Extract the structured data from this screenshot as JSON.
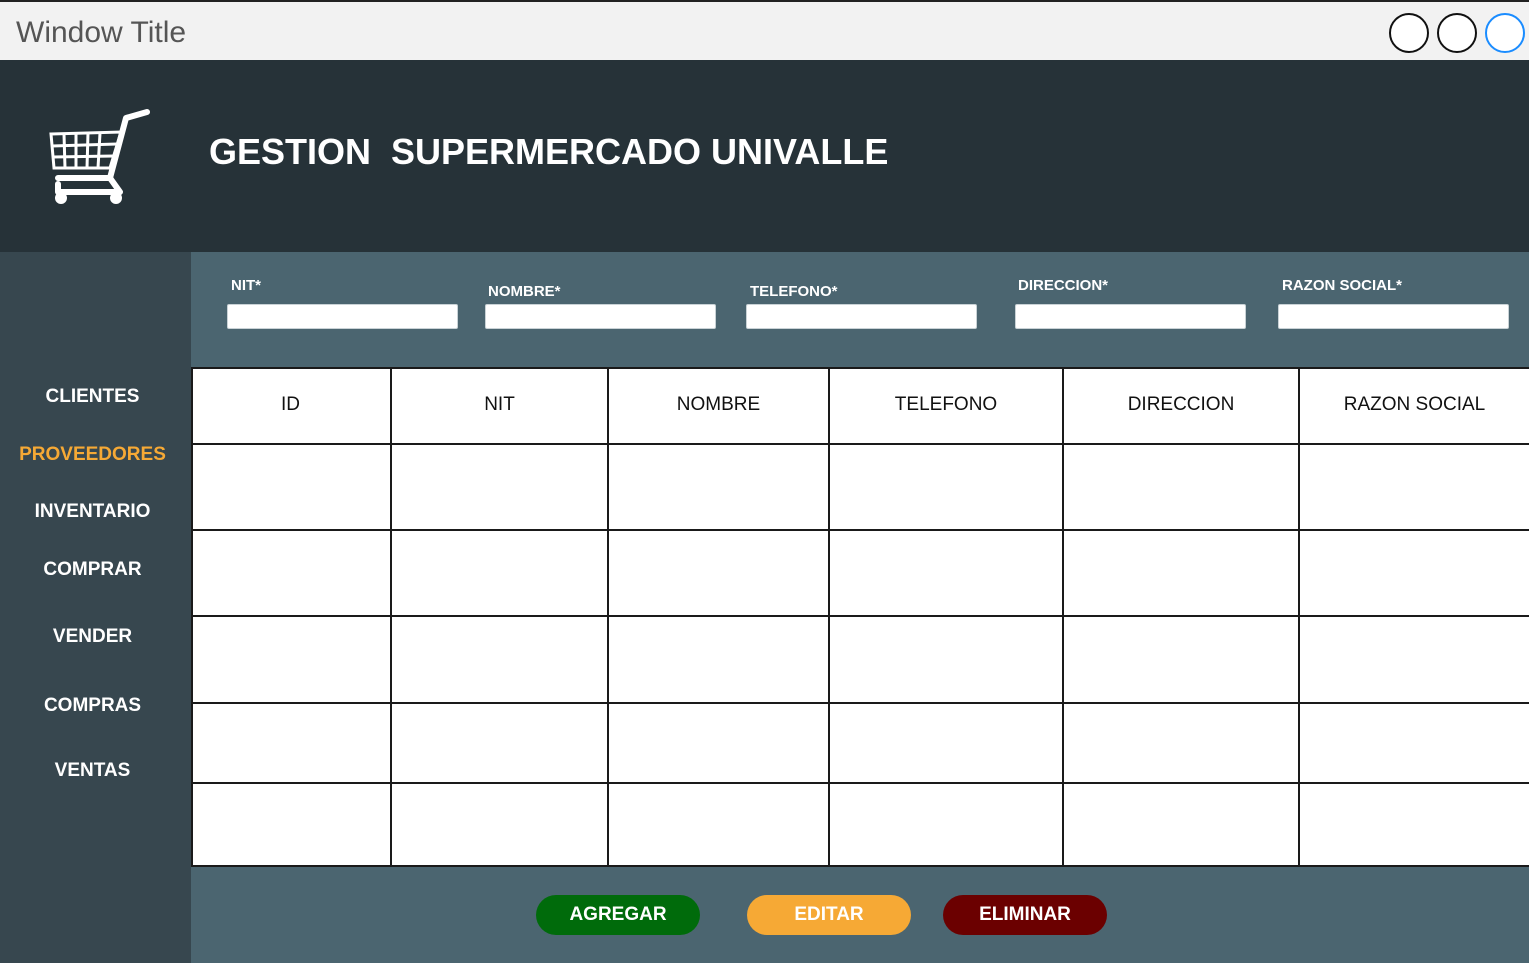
{
  "window": {
    "title": "Window Title"
  },
  "header": {
    "title": "GESTION  SUPERMERCADO UNIVALLE"
  },
  "sidebar": {
    "items": [
      {
        "label": "CLIENTES",
        "active": false
      },
      {
        "label": "PROVEEDORES",
        "active": true
      },
      {
        "label": "INVENTARIO",
        "active": false
      },
      {
        "label": "COMPRAR",
        "active": false
      },
      {
        "label": "VENDER",
        "active": false
      },
      {
        "label": "COMPRAS",
        "active": false
      },
      {
        "label": "VENTAS",
        "active": false
      }
    ]
  },
  "form": {
    "fields": [
      {
        "label": "NIT*",
        "value": ""
      },
      {
        "label": "NOMBRE*",
        "value": ""
      },
      {
        "label": "TELEFONO*",
        "value": ""
      },
      {
        "label": "DIRECCION*",
        "value": ""
      },
      {
        "label": "RAZON SOCIAL*",
        "value": ""
      }
    ]
  },
  "table": {
    "columns": [
      "ID",
      "NIT",
      "NOMBRE",
      "TELEFONO",
      "DIRECCION",
      "RAZON SOCIAL"
    ],
    "rows": [
      [
        "",
        "",
        "",
        "",
        "",
        ""
      ],
      [
        "",
        "",
        "",
        "",
        "",
        ""
      ],
      [
        "",
        "",
        "",
        "",
        "",
        ""
      ],
      [
        "",
        "",
        "",
        "",
        "",
        ""
      ],
      [
        "",
        "",
        "",
        "",
        "",
        ""
      ]
    ]
  },
  "actions": {
    "add_label": "AGREGAR",
    "edit_label": "EDITAR",
    "delete_label": "ELIMINAR"
  },
  "colors": {
    "header_bg": "#263238",
    "sidebar_bg": "#37474f",
    "panel_bg": "#4b6570",
    "active_nav": "#f6a935",
    "add_button": "#006b0b",
    "edit_button": "#f6a935",
    "delete_button": "#6b0000"
  },
  "icons": {
    "app_logo": "shopping-cart-icon",
    "window_controls": [
      "circle-button",
      "circle-button",
      "circle-button"
    ]
  }
}
